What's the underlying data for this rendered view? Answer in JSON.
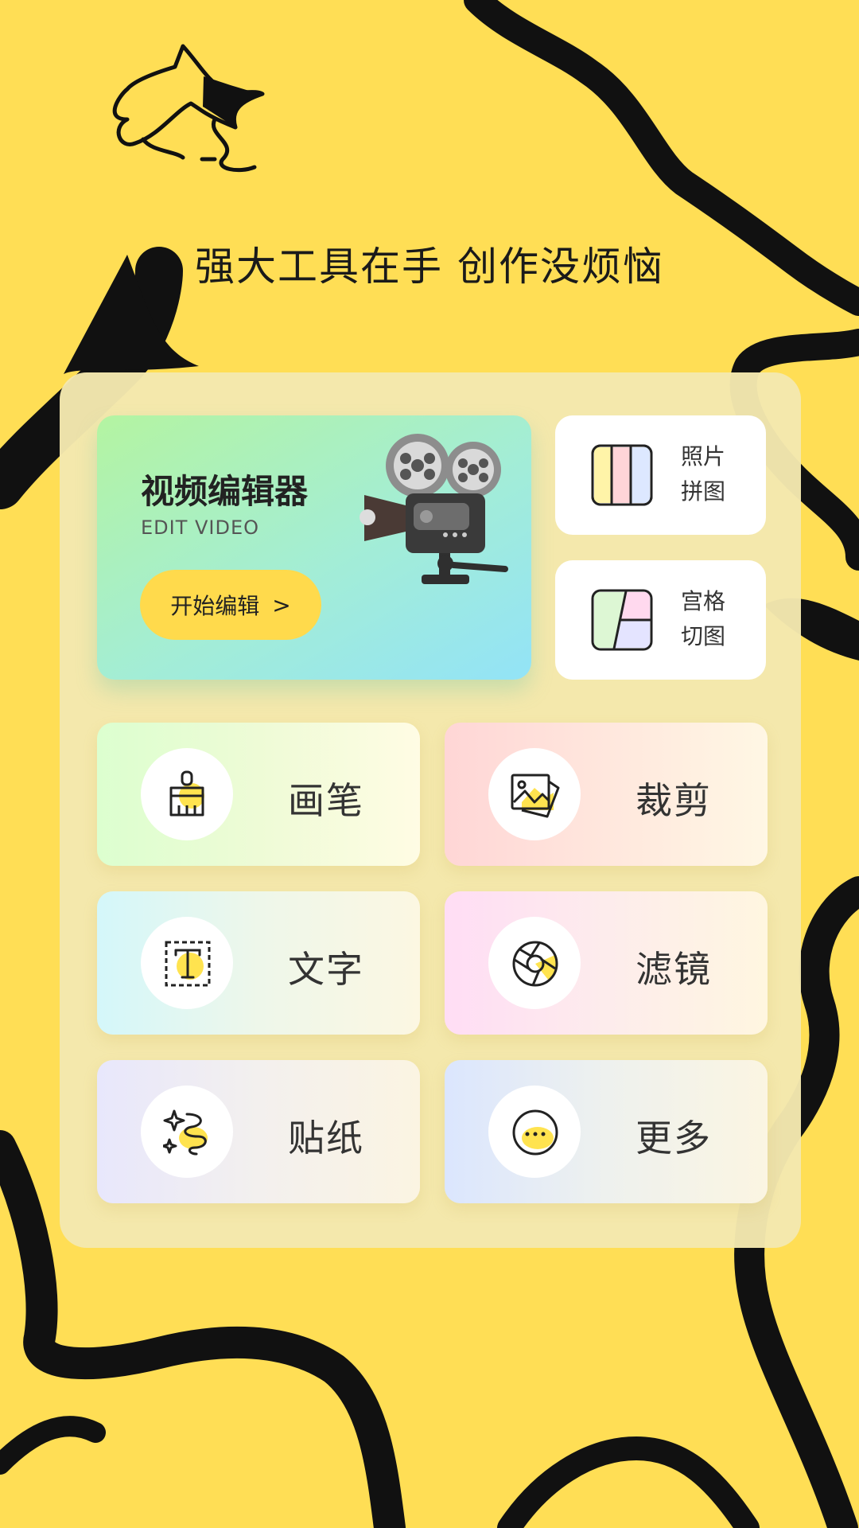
{
  "headline": "强大工具在手 创作没烦恼",
  "video_editor": {
    "title": "视频编辑器",
    "subtitle": "EDIT VIDEO",
    "button_label": "开始编辑",
    "button_chevron": ">"
  },
  "side_cards": [
    {
      "label": "照片拼图",
      "icon": "photo-collage-icon"
    },
    {
      "label": "宫格切图",
      "icon": "grid-cut-icon"
    }
  ],
  "tools": [
    {
      "label": "画笔",
      "icon": "brush-icon"
    },
    {
      "label": "裁剪",
      "icon": "crop-image-icon"
    },
    {
      "label": "文字",
      "icon": "text-icon"
    },
    {
      "label": "滤镜",
      "icon": "aperture-filter-icon"
    },
    {
      "label": "贴纸",
      "icon": "sticker-sparkle-icon"
    },
    {
      "label": "更多",
      "icon": "more-icon"
    }
  ],
  "colors": {
    "background": "#FFDE55",
    "accent_yellow": "#FFDA4C",
    "panel": "#F4E8B0",
    "ink": "#111111"
  }
}
